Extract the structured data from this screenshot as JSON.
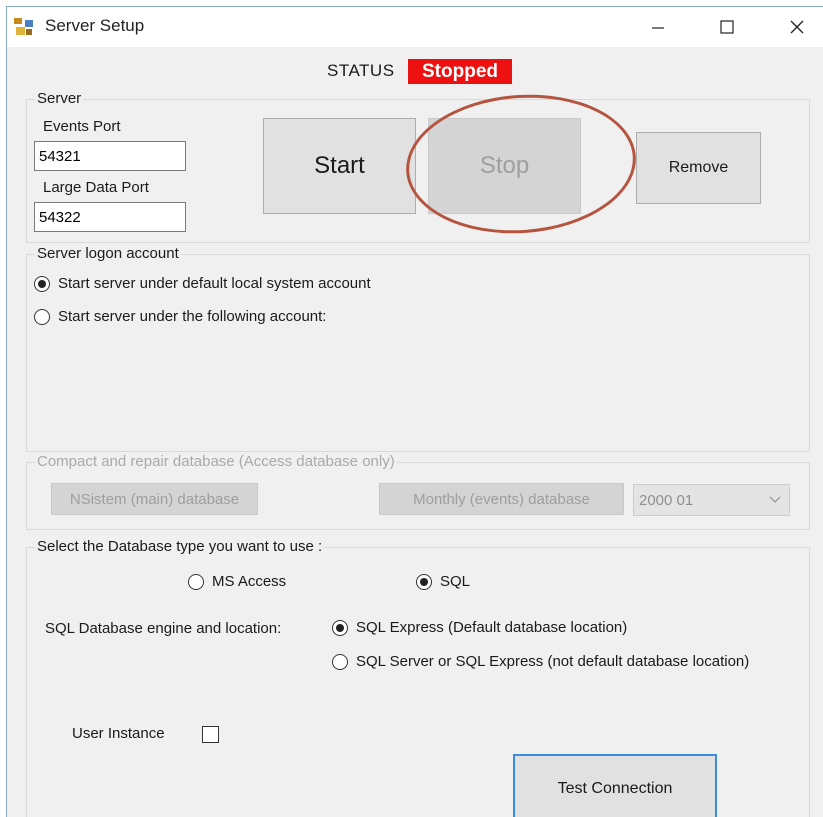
{
  "window": {
    "title": "Server Setup"
  },
  "title_controls": {
    "minimize_icon": "minimize-icon",
    "maximize_icon": "maximize-icon",
    "close_icon": "close-icon"
  },
  "status": {
    "label": "STATUS",
    "value": "Stopped",
    "color": "#ee1111"
  },
  "server": {
    "group_label": "Server",
    "events_port_label": "Events Port",
    "events_port_value": "54321",
    "large_data_port_label": "Large Data Port",
    "large_data_port_value": "54322",
    "start_label": "Start",
    "stop_label": "Stop",
    "remove_label": "Remove"
  },
  "logon": {
    "group_label": "Server logon account",
    "option_default": "Start server under default local system account",
    "option_following": "Start server under the following account:"
  },
  "compact": {
    "group_label": "Compact and repair database (Access database only)",
    "main_db_label": "NSistem (main) database",
    "monthly_db_label": "Monthly (events) database",
    "month_selected": "2000 01"
  },
  "database": {
    "group_label": "Select the Database type you want to use :",
    "ms_access_label": "MS Access",
    "sql_label": "SQL",
    "engine_label": "SQL Database engine and location:",
    "sql_express_label": "SQL Express (Default database location)",
    "sql_server_label": "SQL Server or SQL Express (not default database location)",
    "user_instance_label": "User Instance",
    "test_connection_label": "Test Connection"
  },
  "colors": {
    "accent": "#3b8be0",
    "highlight_ellipse": "#b5553f"
  }
}
